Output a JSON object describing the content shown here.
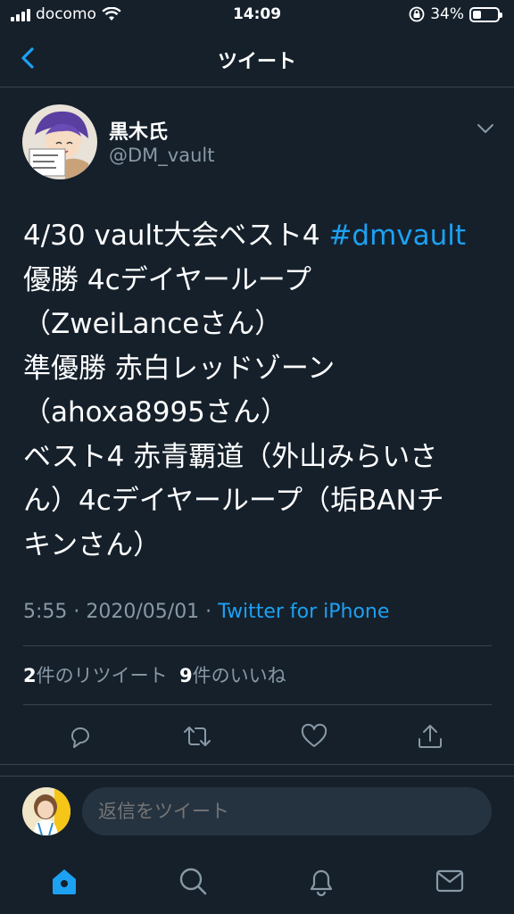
{
  "status_bar": {
    "carrier": "docomo",
    "time": "14:09",
    "battery_percent": "34%",
    "battery_level": 0.34
  },
  "header": {
    "title": "ツイート",
    "back_icon": "chevron-left-icon"
  },
  "tweet": {
    "author_name": "黒木氏",
    "author_handle": "@DM_vault",
    "text_lines": [
      "4/30 vault大会ベスト4 ",
      "優勝 4cデイヤーループ",
      "（ZweiLanceさん）",
      "準優勝 赤白レッドゾーン",
      "（ahoxa8995さん）",
      "ベスト4 赤青覇道（外山みらいさ",
      "ん）4cデイヤーループ（垢BANチ",
      "キンさん）"
    ],
    "hashtag": "#dmvault",
    "timestamp": "5:55 · 2020/05/01 · ",
    "source": "Twitter for iPhone",
    "retweet_count": "2",
    "retweet_label": "件のリツイート",
    "like_count": "9",
    "like_label": "件のいいね"
  },
  "actions": [
    "reply-icon",
    "retweet-icon",
    "like-icon",
    "share-icon"
  ],
  "reply": {
    "placeholder": "返信をツイート"
  },
  "tabbar": [
    "home-icon",
    "search-icon",
    "notifications-icon",
    "messages-icon"
  ],
  "colors": {
    "background": "#15202b",
    "accent": "#1da1f2",
    "secondary_text": "#8899a6",
    "divider": "#38444d"
  }
}
